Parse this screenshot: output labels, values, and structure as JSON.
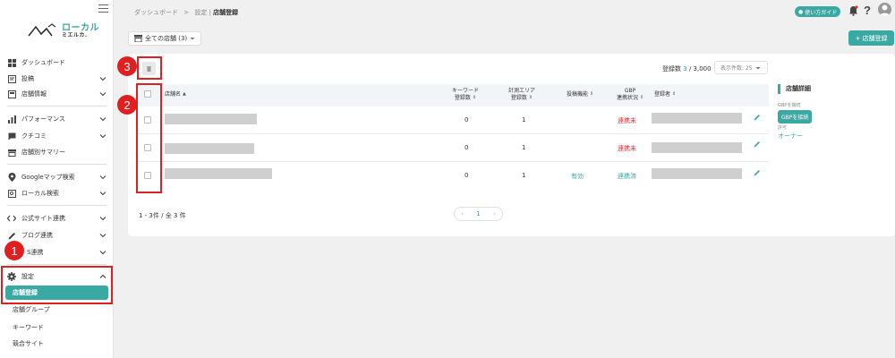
{
  "sidebar": {
    "logo": {
      "line1": "ローカル",
      "line2": "ミエルカ."
    },
    "items": [
      {
        "label": "ダッシュボード",
        "icon": "dashboard-icon"
      },
      {
        "label": "投稿",
        "icon": "post-icon"
      },
      {
        "label": "店舗情報",
        "icon": "store-info-icon"
      },
      {
        "label": "パフォーマンス",
        "icon": "performance-icon"
      },
      {
        "label": "クチコミ",
        "icon": "review-icon"
      },
      {
        "label": "店舗別サマリー",
        "icon": "summary-icon"
      },
      {
        "label": "Googleマップ検索",
        "icon": "map-pin-icon"
      },
      {
        "label": "ローカル検索",
        "icon": "local-search-icon"
      },
      {
        "label": "公式サイト連携",
        "icon": "code-icon"
      },
      {
        "label": "ブログ連携",
        "icon": "pencil-icon"
      },
      {
        "label": "S連携",
        "icon": "sns-icon"
      },
      {
        "label": "設定",
        "icon": "gear-icon"
      }
    ],
    "sub_items": [
      "店舗登録",
      "店舗グループ",
      "キーワード",
      "競合サイト"
    ]
  },
  "header": {
    "breadcrumb_1": "ダッシュボード",
    "breadcrumb_sep": ">",
    "breadcrumb_2": "設定 |",
    "breadcrumb_current": "店舗登録",
    "guide_label": "使い方ガイド",
    "help": "?"
  },
  "toolbar": {
    "store_filter": "全ての店舗 (3)",
    "add_store": "+ 店舗登録"
  },
  "summary": {
    "count_label": "登録数",
    "count_value": "3",
    "count_total": "/ 3,000",
    "per_page": "表示件数: 25"
  },
  "table": {
    "headers": {
      "store_name": "店舗名",
      "keyword_1": "キーワード",
      "keyword_2": "登録数",
      "area_1": "計測エリア",
      "area_2": "登録数",
      "post": "投稿機能",
      "gbp_1": "GBP",
      "gbp_2": "連携状況",
      "registrant": "登録者"
    },
    "rows": [
      {
        "keywords": "0",
        "areas": "1",
        "post": "",
        "gbp": "連携未"
      },
      {
        "keywords": "0",
        "areas": "1",
        "post": "",
        "gbp": "連携未"
      },
      {
        "keywords": "0",
        "areas": "1",
        "post": "有効",
        "gbp": "連携済"
      }
    ],
    "footer_count": "1 - 3件 / 全 3 件",
    "page": "1"
  },
  "detail": {
    "title": "店舗詳細",
    "gbp_label": "GBPを接続",
    "gbp_button": "GBPを接続",
    "perm_label": "許可",
    "owner": "オーナー"
  },
  "badges": [
    "1",
    "2",
    "3"
  ],
  "colors": {
    "accent": "#3aa8a3",
    "highlight": "#e02020"
  }
}
